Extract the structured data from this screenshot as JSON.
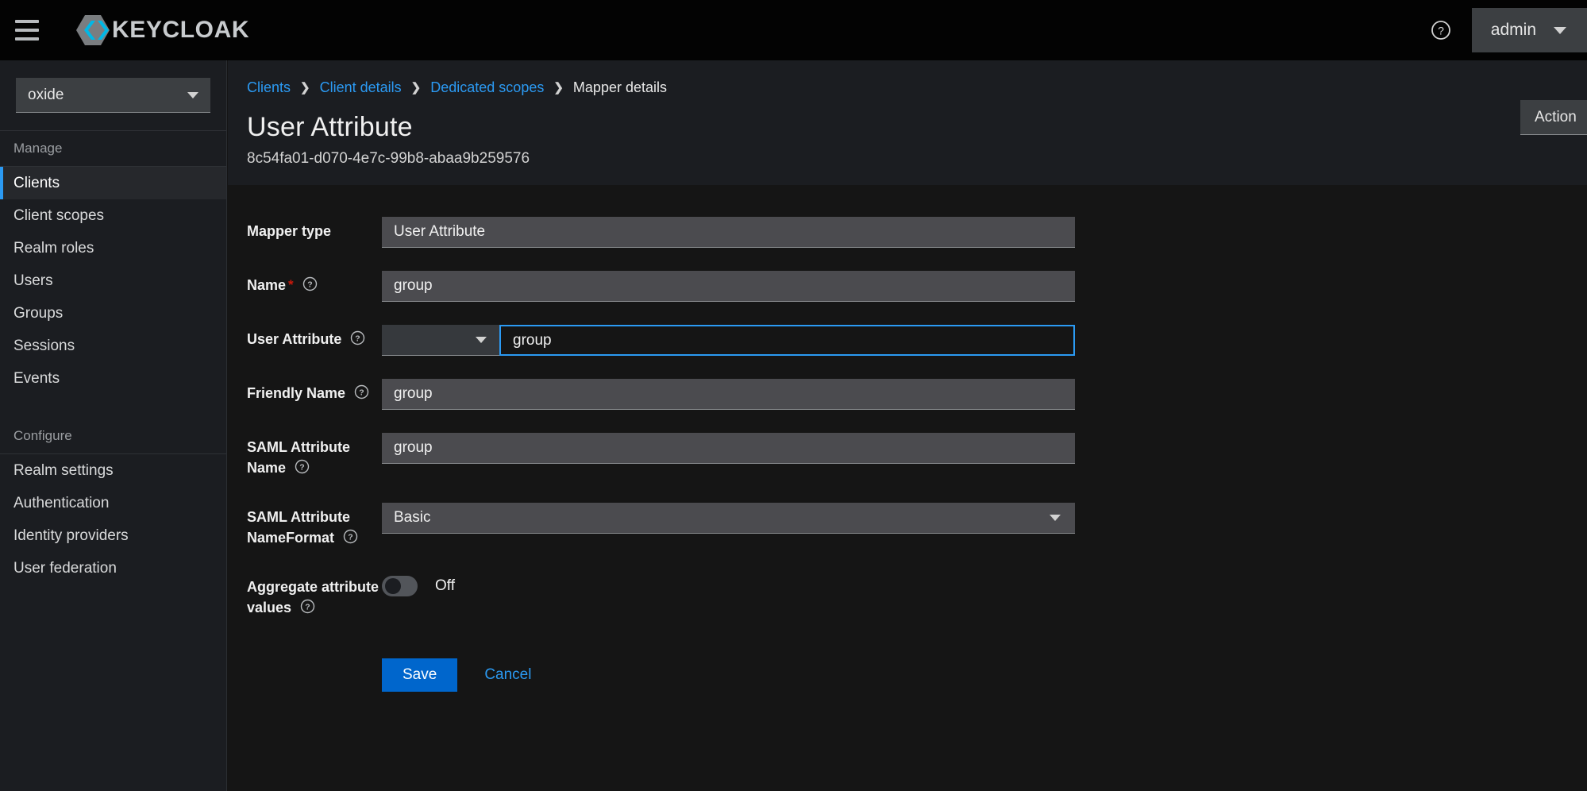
{
  "masthead": {
    "menu_icon": "hamburger-icon",
    "brand_text": "KEYCLOAK",
    "help_icon": "help-circle-icon",
    "user_label": "admin"
  },
  "sidebar": {
    "realm_selector": {
      "value": "oxide"
    },
    "sections": [
      {
        "title": "Manage",
        "items": [
          {
            "label": "Clients",
            "active": true
          },
          {
            "label": "Client scopes",
            "active": false
          },
          {
            "label": "Realm roles",
            "active": false
          },
          {
            "label": "Users",
            "active": false
          },
          {
            "label": "Groups",
            "active": false
          },
          {
            "label": "Sessions",
            "active": false
          },
          {
            "label": "Events",
            "active": false
          }
        ]
      },
      {
        "title": "Configure",
        "items": [
          {
            "label": "Realm settings",
            "active": false
          },
          {
            "label": "Authentication",
            "active": false
          },
          {
            "label": "Identity providers",
            "active": false
          },
          {
            "label": "User federation",
            "active": false
          }
        ]
      }
    ]
  },
  "page": {
    "breadcrumb": [
      {
        "label": "Clients",
        "link": true
      },
      {
        "label": "Client details",
        "link": true
      },
      {
        "label": "Dedicated scopes",
        "link": true
      },
      {
        "label": "Mapper details",
        "link": false
      }
    ],
    "breadcrumb_separator": "❯",
    "title": "User Attribute",
    "subtitle": "8c54fa01-d070-4e7c-99b8-abaa9b259576",
    "action_dropdown_label": "Action"
  },
  "form": {
    "mapper_type": {
      "label": "Mapper type",
      "value": "User Attribute"
    },
    "name": {
      "label": "Name",
      "required_marker": "*",
      "value": "group"
    },
    "user_attribute": {
      "label": "User Attribute",
      "select_value": "",
      "value": "group",
      "focused": true
    },
    "friendly_name": {
      "label": "Friendly Name",
      "value": "group"
    },
    "saml_attribute_name": {
      "label": "SAML Attribute Name",
      "value": "group"
    },
    "saml_name_format": {
      "label": "SAML Attribute NameFormat",
      "value": "Basic"
    },
    "aggregate": {
      "label": "Aggregate attribute values",
      "state_label": "Off",
      "enabled": false
    },
    "save_label": "Save",
    "cancel_label": "Cancel"
  },
  "colors": {
    "accent_blue": "#0066cc",
    "link_blue": "#2b9af3",
    "required_red": "#c9190b",
    "masthead_bg": "#030303",
    "sidebar_bg": "#1b1d21",
    "content_bg": "#151515",
    "input_bg": "#4b4b4f"
  }
}
